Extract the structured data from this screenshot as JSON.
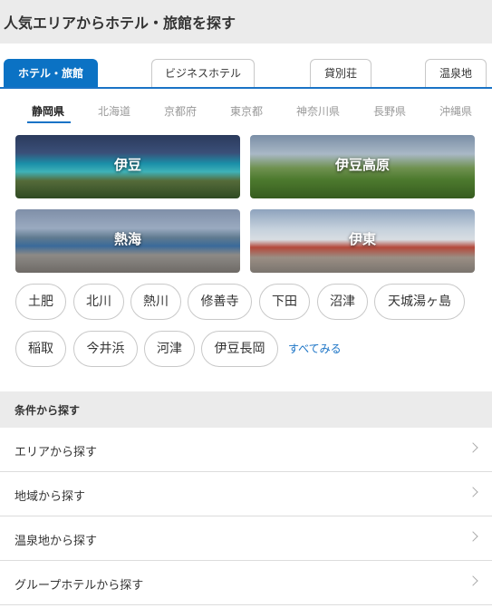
{
  "header": {
    "title": "人気エリアからホテル・旅館を探す"
  },
  "tabs": [
    {
      "label": "ホテル・旅館",
      "active": true
    },
    {
      "label": "ビジネスホテル",
      "active": false
    },
    {
      "label": "貸別荘",
      "active": false
    },
    {
      "label": "温泉地",
      "active": false
    }
  ],
  "prefectures": [
    {
      "label": "静岡県",
      "active": true
    },
    {
      "label": "北海道",
      "active": false
    },
    {
      "label": "京都府",
      "active": false
    },
    {
      "label": "東京都",
      "active": false
    },
    {
      "label": "神奈川県",
      "active": false
    },
    {
      "label": "長野県",
      "active": false
    },
    {
      "label": "沖縄県",
      "active": false
    }
  ],
  "area_cards": [
    {
      "label": "伊豆"
    },
    {
      "label": "伊豆高原"
    },
    {
      "label": "熱海"
    },
    {
      "label": "伊東"
    }
  ],
  "area_chips": [
    "土肥",
    "北川",
    "熱川",
    "修善寺",
    "下田",
    "沼津",
    "天城湯ヶ島",
    "稲取",
    "今井浜",
    "河津",
    "伊豆長岡"
  ],
  "see_all_label": "すべてみる",
  "conditions": {
    "title": "条件から探す",
    "items": [
      "エリアから探す",
      "地域から探す",
      "温泉地から探す",
      "グループホテルから探す"
    ]
  },
  "colors": {
    "accent": "#0b72c4",
    "link": "#1a73c6",
    "section_bg": "#ebebeb"
  }
}
